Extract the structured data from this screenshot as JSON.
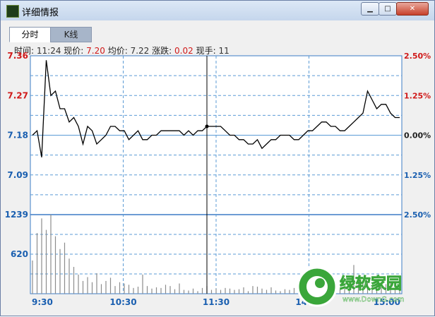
{
  "window": {
    "title": "详细情报",
    "min_glyph": "▁",
    "max_glyph": "□",
    "close_glyph": "✕"
  },
  "tabs": [
    {
      "label": "分时"
    },
    {
      "label": "K线"
    }
  ],
  "info": {
    "time_label": "时间:",
    "time": "11:24",
    "price_label": "现价:",
    "price": "7.20",
    "avg_label": "均价:",
    "avg": "7.22",
    "change_label": "涨跌:",
    "change": "0.02",
    "hand_label": "现手:",
    "hand": "11"
  },
  "colors": {
    "price_up": "#d01a1a",
    "price_flat": "#1a5fb0",
    "price_down": "#1a5fb0",
    "grid": "#5b9bd5",
    "line": "#000000",
    "volume": "#8c8c8c"
  },
  "chart_data": {
    "type": "line",
    "title": "",
    "price": {
      "y_ticks": [
        "7.36",
        "7.27",
        "7.18",
        "7.09"
      ],
      "y_pct_ticks": [
        "2.50%",
        "1.25%",
        "0.00%",
        "1.25%"
      ],
      "ylim": [
        7.0,
        7.36
      ],
      "base": 7.18,
      "x": [
        "9:30",
        "9:33",
        "9:36",
        "9:39",
        "9:42",
        "9:45",
        "9:48",
        "9:51",
        "9:54",
        "9:57",
        "10:00",
        "10:03",
        "10:06",
        "10:09",
        "10:12",
        "10:15",
        "10:18",
        "10:21",
        "10:24",
        "10:27",
        "10:30",
        "10:33",
        "10:36",
        "10:39",
        "10:42",
        "10:45",
        "10:48",
        "10:51",
        "10:54",
        "10:57",
        "11:00",
        "11:03",
        "11:06",
        "11:09",
        "11:12",
        "11:15",
        "11:18",
        "11:21",
        "11:24",
        "11:27",
        "11:30",
        "13:03",
        "13:06",
        "13:09",
        "13:12",
        "13:15",
        "13:18",
        "13:21",
        "13:24",
        "13:27",
        "13:30",
        "13:33",
        "13:36",
        "13:39",
        "13:42",
        "13:45",
        "13:48",
        "13:51",
        "13:54",
        "13:57",
        "14:00",
        "14:03",
        "14:06",
        "14:09",
        "14:12",
        "14:15",
        "14:18",
        "14:21",
        "14:24",
        "14:27",
        "14:30",
        "14:33",
        "14:36",
        "14:39",
        "14:42",
        "14:45",
        "14:48",
        "14:51",
        "14:54",
        "14:57",
        "15:00"
      ],
      "values": [
        7.18,
        7.19,
        7.13,
        7.35,
        7.27,
        7.28,
        7.24,
        7.24,
        7.21,
        7.22,
        7.2,
        7.16,
        7.2,
        7.19,
        7.16,
        7.17,
        7.18,
        7.2,
        7.2,
        7.19,
        7.19,
        7.17,
        7.18,
        7.19,
        7.17,
        7.17,
        7.18,
        7.18,
        7.19,
        7.19,
        7.19,
        7.19,
        7.19,
        7.18,
        7.19,
        7.18,
        7.19,
        7.19,
        7.2,
        7.2,
        7.2,
        7.2,
        7.19,
        7.18,
        7.18,
        7.17,
        7.17,
        7.16,
        7.16,
        7.17,
        7.15,
        7.16,
        7.17,
        7.17,
        7.18,
        7.18,
        7.18,
        7.17,
        7.17,
        7.18,
        7.19,
        7.19,
        7.2,
        7.21,
        7.21,
        7.2,
        7.2,
        7.19,
        7.19,
        7.2,
        7.21,
        7.22,
        7.23,
        7.28,
        7.26,
        7.24,
        7.25,
        7.25,
        7.23,
        7.22,
        7.22
      ]
    },
    "volume": {
      "y_ticks": [
        "1239",
        "620"
      ],
      "y_pct_ticks": [
        "2.50%"
      ],
      "ylim": [
        0,
        1239
      ],
      "values": [
        520,
        950,
        1180,
        1000,
        1239,
        900,
        700,
        800,
        550,
        420,
        300,
        200,
        260,
        180,
        320,
        150,
        200,
        250,
        120,
        180,
        160,
        140,
        90,
        110,
        300,
        120,
        80,
        100,
        90,
        140,
        120,
        70,
        160,
        60,
        50,
        80,
        40,
        90,
        120,
        60,
        80,
        60,
        90,
        80,
        60,
        70,
        100,
        40,
        120,
        110,
        80,
        60,
        100,
        50,
        40,
        70,
        60,
        90,
        80,
        100,
        70,
        60,
        80,
        90,
        70,
        80,
        60,
        70,
        80,
        60,
        450,
        150,
        180,
        200,
        130,
        160,
        100,
        150,
        180,
        90,
        100
      ]
    },
    "x_ticks": [
      "9:30",
      "10:30",
      "11:30",
      "14:00",
      "15:00"
    ]
  },
  "watermark": {
    "brand_text": "绿软家园",
    "site_text": "www.DownG.com"
  }
}
